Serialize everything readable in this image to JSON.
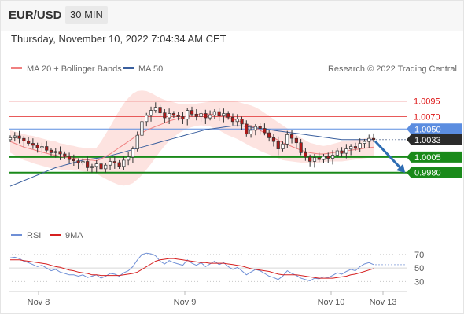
{
  "header": {
    "symbol": "EUR/USD",
    "timeframe": "30 MIN",
    "datetime": "Thursday, November 10, 2022 7:04:34 AM CET"
  },
  "colors": {
    "ma20": "#f08080",
    "ma50": "#3a5f9e",
    "band_fill": "#fde3e0",
    "resistance": "#e85a5a",
    "pivot": "#5b8de0",
    "support": "#1a8a1a",
    "candle_up": "#ffffff",
    "candle_down": "#b01818",
    "rsi": "#6f8fd6",
    "rsi_ma": "#d62020",
    "arrow": "#2f6db3"
  },
  "legend": {
    "ma20_label": "MA 20 + Bollinger Bands",
    "ma50_label": "MA 50",
    "source": "Research © 2022 Trading Central"
  },
  "rsi_legend": {
    "rsi_label": "RSI",
    "ma_label": "9MA"
  },
  "chart_data": [
    {
      "type": "candlestick",
      "ylim": [
        0.99,
        1.013
      ],
      "levels": [
        {
          "value": 1.0095,
          "label": "1.0095",
          "kind": "resistance"
        },
        {
          "value": 1.007,
          "label": "1.0070",
          "kind": "resistance"
        },
        {
          "value": 1.005,
          "label": "1.0050",
          "kind": "pivot"
        },
        {
          "value": 1.0005,
          "label": "1.0005",
          "kind": "support"
        },
        {
          "value": 0.998,
          "label": "0.9980",
          "kind": "support"
        }
      ],
      "last_price": {
        "value": 1.0033,
        "label": "1.0033"
      },
      "x_ticks": [
        "Nov 8",
        "Nov 9",
        "Nov 10",
        "Nov 13"
      ],
      "close": [
        1.0036,
        1.0039,
        1.0035,
        1.0031,
        1.0027,
        1.0024,
        1.002,
        1.0022,
        1.0016,
        1.0012,
        1.0014,
        1.001,
        1.0006,
        1.0001,
        0.9999,
        0.9996,
        0.9998,
        0.9988,
        0.999,
        0.9994,
        0.9986,
        0.9992,
        0.9998,
        0.9996,
        0.999,
        1.0,
        1.0005,
        1.0018,
        1.004,
        1.0062,
        1.0072,
        1.008,
        1.0085,
        1.0076,
        1.0068,
        1.0075,
        1.0072,
        1.007,
        1.0066,
        1.008,
        1.0074,
        1.007,
        1.0075,
        1.0068,
        1.0072,
        1.0078,
        1.0071,
        1.0075,
        1.0069,
        1.0062,
        1.0066,
        1.0058,
        1.0042,
        1.0048,
        1.0054,
        1.0051,
        1.0044,
        1.0036,
        1.003,
        1.0018,
        1.0026,
        1.0041,
        1.0035,
        1.0028,
        1.0012,
        1.0005,
        0.9998,
        1.0004,
        1.0001,
        1.0006,
        1.0003,
        1.0008,
        1.0015,
        1.0011,
        1.0018,
        1.0022,
        1.0019,
        1.0027,
        1.003,
        1.0035,
        1.0033
      ],
      "ma20": [
        1.003,
        1.0027,
        1.0024,
        1.0021,
        1.0019,
        1.0017,
        1.0015,
        1.0013,
        1.0011,
        1.0009,
        1.0008,
        1.0006,
        1.0005,
        1.0004,
        1.0003,
        1.0002,
        1.0001,
        1.0,
        1.0,
        0.9999,
        1.0002,
        1.0006,
        1.001,
        1.0015,
        1.002,
        1.0025,
        1.003,
        1.0035,
        1.004,
        1.0044,
        1.0048,
        1.0051,
        1.0054,
        1.0057,
        1.006,
        1.0063,
        1.0065,
        1.0067,
        1.0069,
        1.0071,
        1.0072,
        1.0073,
        1.0074,
        1.0074,
        1.0074,
        1.0073,
        1.0072,
        1.007,
        1.0068,
        1.0066,
        1.0064,
        1.0061,
        1.0058,
        1.0055,
        1.0052,
        1.0048,
        1.0044,
        1.004,
        1.0036,
        1.0032,
        1.0028,
        1.0025,
        1.0022,
        1.0019,
        1.0016,
        1.0014,
        1.0012,
        1.0011,
        1.001,
        1.001,
        1.0011,
        1.0012,
        1.0013,
        1.0014,
        1.0015,
        1.0016,
        1.0017,
        1.0018,
        1.0019,
        1.002,
        1.0021
      ],
      "ma50": [
        0.9958,
        0.9961,
        0.9964,
        0.9967,
        0.997,
        0.9973,
        0.9976,
        0.9979,
        0.9982,
        0.9985,
        0.9988,
        0.999,
        0.9992,
        0.9994,
        0.9996,
        0.9998,
        1.0,
        1.0001,
        1.0002,
        1.0003,
        1.0004,
        1.0005,
        1.0007,
        1.0009,
        1.0011,
        1.0013,
        1.0015,
        1.0017,
        1.0019,
        1.0021,
        1.0023,
        1.0025,
        1.0027,
        1.0029,
        1.0031,
        1.0033,
        1.0035,
        1.0037,
        1.0039,
        1.0041,
        1.0043,
        1.0045,
        1.0047,
        1.0049,
        1.005,
        1.0051,
        1.0052,
        1.0053,
        1.0054,
        1.0055,
        1.0055,
        1.0055,
        1.0054,
        1.0053,
        1.0052,
        1.0051,
        1.005,
        1.0049,
        1.0048,
        1.0047,
        1.0046,
        1.0045,
        1.0044,
        1.0043,
        1.0042,
        1.0041,
        1.004,
        1.0039,
        1.0038,
        1.0037,
        1.0036,
        1.0035,
        1.0034,
        1.0033,
        1.0033,
        1.0033,
        1.0033,
        1.0033,
        1.0033,
        1.0033,
        1.0033
      ],
      "band_width": [
        0.0018,
        0.0019,
        0.002,
        0.0021,
        0.0021,
        0.0022,
        0.0022,
        0.0022,
        0.0022,
        0.0022,
        0.0022,
        0.0021,
        0.0021,
        0.002,
        0.002,
        0.0019,
        0.0019,
        0.0019,
        0.002,
        0.0021,
        0.0028,
        0.0036,
        0.0044,
        0.0052,
        0.006,
        0.0066,
        0.007,
        0.0072,
        0.0071,
        0.0068,
        0.0063,
        0.0057,
        0.005,
        0.0043,
        0.0037,
        0.0032,
        0.0028,
        0.0024,
        0.0022,
        0.002,
        0.0019,
        0.0018,
        0.0018,
        0.0019,
        0.002,
        0.0022,
        0.0024,
        0.0026,
        0.0028,
        0.0029,
        0.003,
        0.0031,
        0.0032,
        0.0033,
        0.0033,
        0.0033,
        0.0032,
        0.0031,
        0.003,
        0.0029,
        0.0028,
        0.0026,
        0.0024,
        0.0022,
        0.002,
        0.0018,
        0.0016,
        0.0015,
        0.0014,
        0.0013,
        0.0013,
        0.0014,
        0.0015,
        0.0016,
        0.0016,
        0.0016,
        0.0016,
        0.0016,
        0.0016,
        0.0016,
        0.0016
      ],
      "projection": {
        "from": 1.0033,
        "to": 0.998
      }
    },
    {
      "type": "line",
      "ylim": [
        20,
        85
      ],
      "y_ticks": [
        70,
        50,
        30
      ],
      "series": [
        {
          "name": "RSI",
          "values": [
            65,
            66,
            64,
            60,
            58,
            55,
            52,
            54,
            50,
            46,
            48,
            44,
            42,
            40,
            40,
            38,
            40,
            36,
            38,
            40,
            35,
            38,
            42,
            41,
            38,
            43,
            46,
            52,
            62,
            70,
            72,
            71,
            68,
            60,
            56,
            61,
            58,
            56,
            54,
            62,
            57,
            54,
            58,
            52,
            56,
            60,
            55,
            58,
            52,
            48,
            51,
            46,
            40,
            44,
            48,
            46,
            42,
            38,
            36,
            33,
            38,
            46,
            42,
            39,
            35,
            33,
            31,
            35,
            34,
            37,
            36,
            39,
            43,
            41,
            45,
            48,
            46,
            52,
            56,
            58,
            55
          ]
        },
        {
          "name": "9MA",
          "values": [
            62,
            62,
            62,
            61,
            60,
            59,
            58,
            57,
            56,
            54,
            52,
            51,
            49,
            47,
            46,
            44,
            43,
            42,
            40,
            40,
            39,
            39,
            39,
            39,
            39,
            40,
            41,
            42,
            44,
            48,
            52,
            56,
            60,
            62,
            63,
            64,
            64,
            63,
            62,
            61,
            60,
            59,
            58,
            58,
            57,
            57,
            57,
            57,
            56,
            55,
            54,
            53,
            51,
            49,
            48,
            47,
            46,
            45,
            43,
            41,
            40,
            40,
            40,
            40,
            39,
            38,
            37,
            36,
            35,
            35,
            35,
            35,
            36,
            37,
            38,
            40,
            41,
            43,
            45,
            47,
            49
          ]
        }
      ]
    }
  ]
}
